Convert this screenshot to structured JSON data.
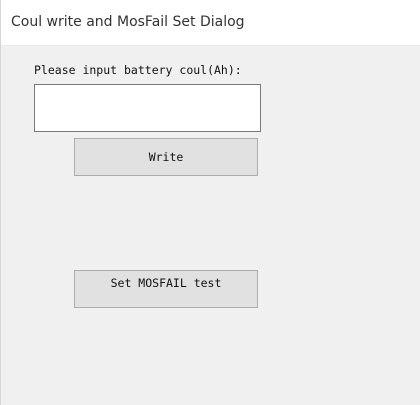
{
  "window": {
    "title": "Coul write and MosFail Set Dialog"
  },
  "form": {
    "prompt_label": "Please input battery coul(Ah):",
    "coul_value": "",
    "coul_placeholder": ""
  },
  "buttons": {
    "write_label": "Write",
    "mosfail_label": "Set MOSFAIL test"
  }
}
